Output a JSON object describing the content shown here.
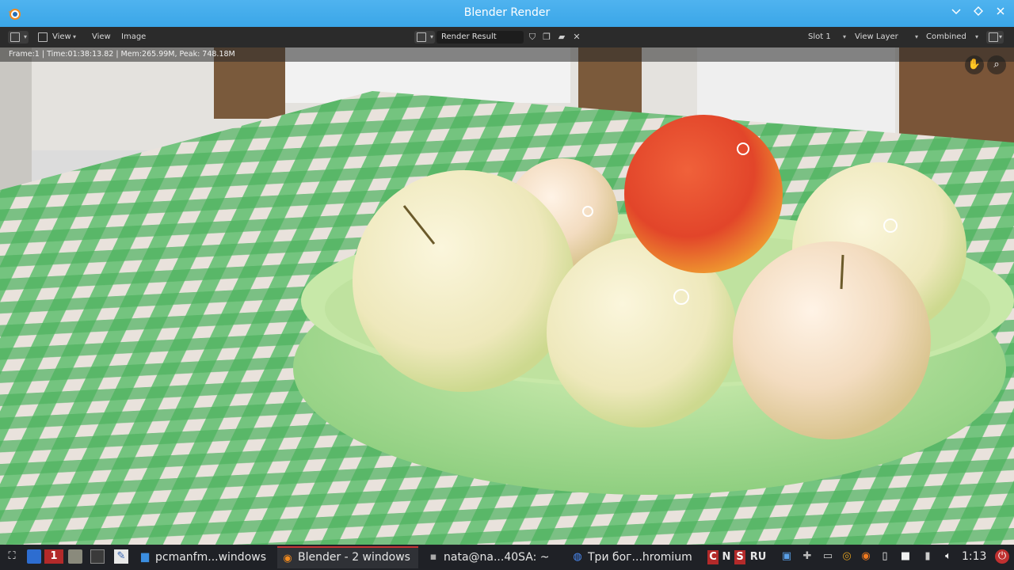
{
  "window": {
    "title": "Blender Render"
  },
  "header": {
    "menu": [
      "View",
      "View",
      "Image"
    ],
    "image_name": "Render Result",
    "slot": "Slot 1",
    "view_layer": "View Layer",
    "pass": "Combined"
  },
  "viewport": {
    "info": "Frame:1 | Time:01:38:13.82 | Mem:265.99M, Peak: 748.18M"
  },
  "taskbar": {
    "workspace_num": "1",
    "tasks": [
      {
        "label": "pcmanfm...windows",
        "icon": "folder-icon"
      },
      {
        "label": "Blender - 2 windows",
        "icon": "blender-icon"
      },
      {
        "label": "nata@na...40SA: ~",
        "icon": "terminal-icon"
      },
      {
        "label": "Три бог...hromium",
        "icon": "chromium-icon"
      }
    ],
    "keyboard": [
      "C",
      "N",
      "S"
    ],
    "layout": "RU",
    "clock": "1:13"
  },
  "colors": {
    "titlebar": "#3aa6e8",
    "active_task_border": "#c53434"
  }
}
